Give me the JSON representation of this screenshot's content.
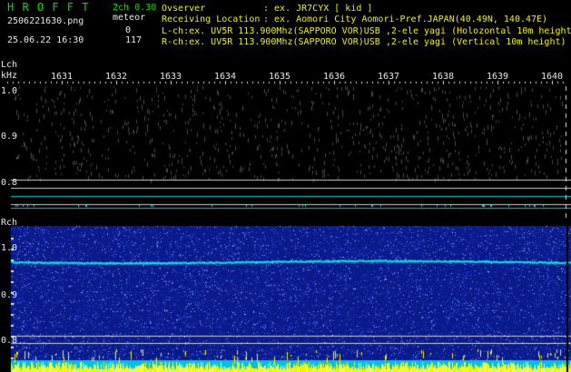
{
  "header": {
    "app_name": "H R O F F T",
    "version": "2ch 0.30",
    "filename": "2506221630.png",
    "datetime": "25.06.22 16:30",
    "meteor_label": "meteor",
    "meteor_l": "0",
    "meteor_r": "117"
  },
  "info": {
    "observer_key": "Ovserver",
    "observer_val": ": ex. JR7CYX [ kid ]",
    "location_key": "Receiving Location",
    "location_val": ": ex. Aomori City Aomori-Pref.JAPAN(40.49N, 140.47E)",
    "lch_line": "L-ch:ex. UV5R 113.900Mhz(SAPPORO VOR)USB ,2-ele yagi (Holozontal 10m height)",
    "rch_line": "R-ch:ex. UV5R 113.900Mhz(SAPPORO VOR)USB ,2-ele yagi (Vertical 10m height)"
  },
  "axis": {
    "lch_label": "Lch",
    "khz_label": "kHz",
    "rch_label": "Rch",
    "freq_ticks": [
      "1631",
      "1632",
      "1633",
      "1634",
      "1635",
      "1636",
      "1637",
      "1638",
      "1639",
      "1640"
    ],
    "lch_levels": [
      "1.0",
      "0.9",
      "0.8"
    ],
    "rch_levels": [
      "1.0",
      "0.9",
      "0.8"
    ]
  },
  "colors": {
    "header_green": "#00e000",
    "text_white": "#e8e8e8",
    "meteor_yellow": "#f2f200",
    "trace_cyan": "#00e5e5",
    "rch_bg": "#0b1a8a"
  }
}
